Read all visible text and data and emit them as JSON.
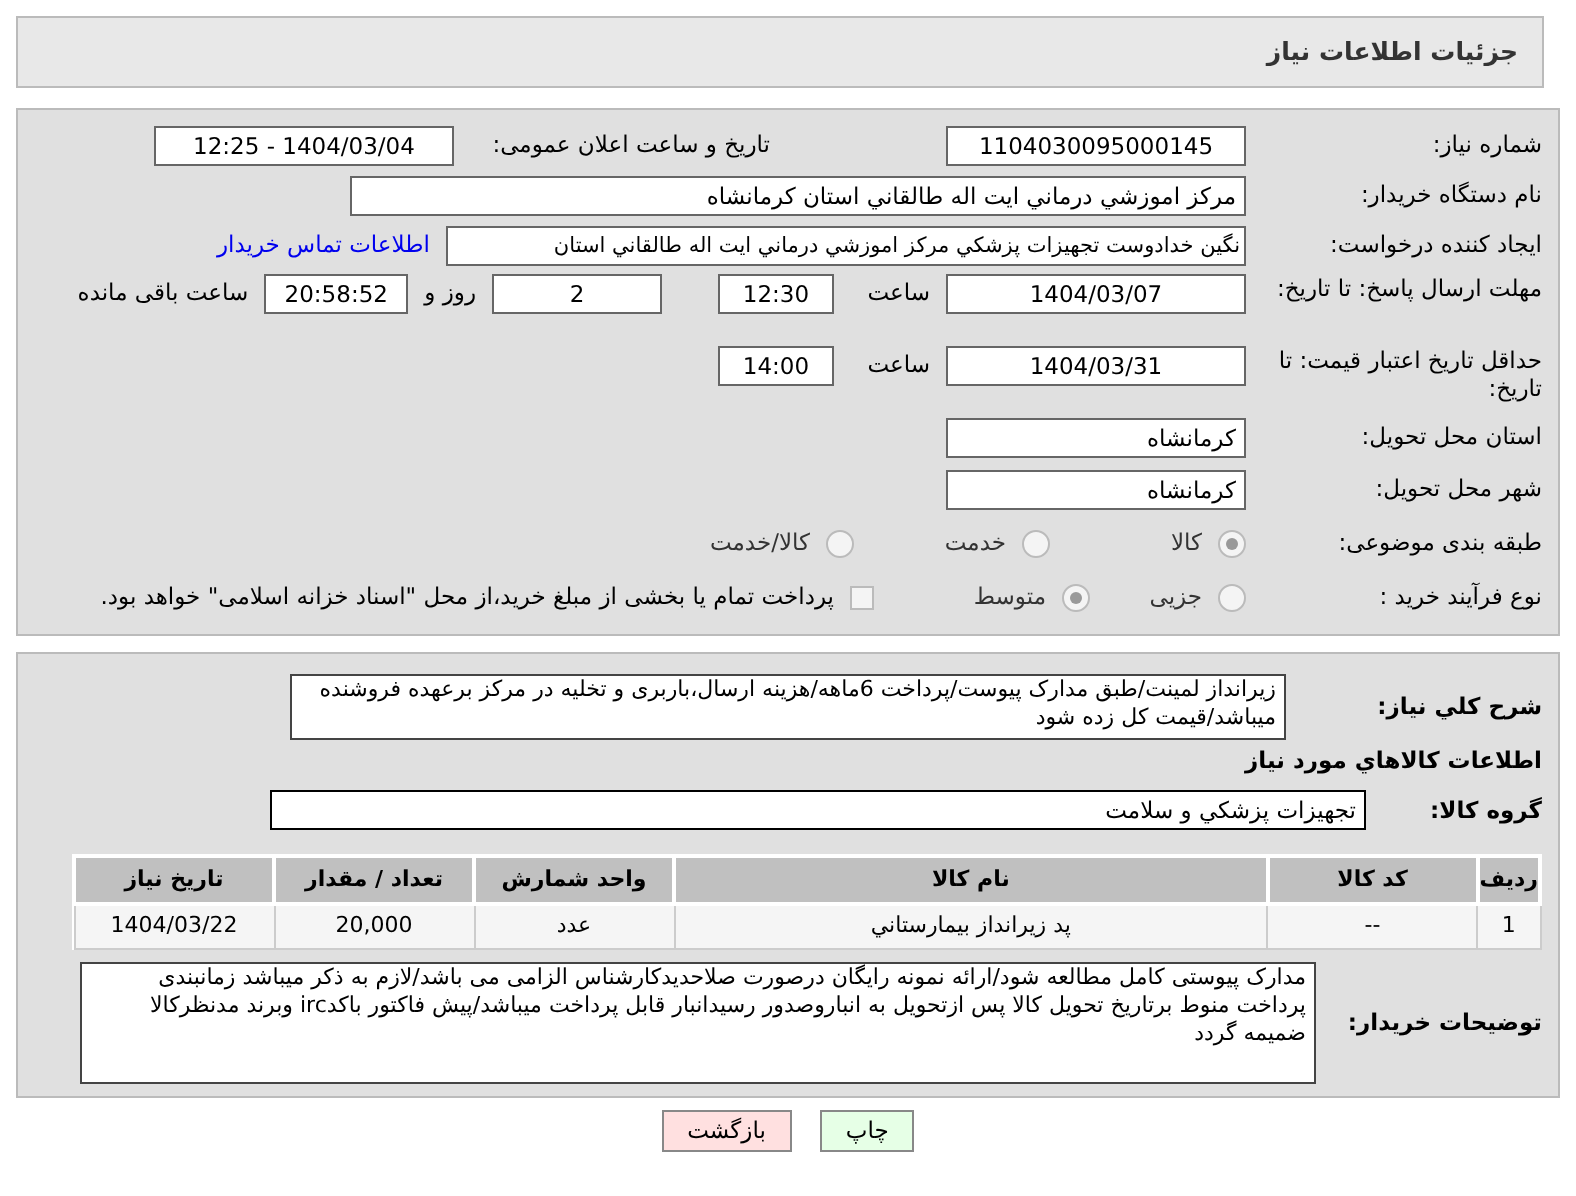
{
  "header": {
    "title": "جزئیات اطلاعات نیاز"
  },
  "fields": {
    "need_number": {
      "label": "شماره نیاز:",
      "value": "1104030095000145"
    },
    "announce": {
      "label": "تاریخ و ساعت اعلان عمومی:",
      "value": "1404/03/04 - 12:25"
    },
    "buyer": {
      "label": "نام دستگاه خریدار:",
      "value": "مرکز اموزشي درماني ايت اله طالقاني استان کرمانشاه"
    },
    "creator": {
      "label": "ایجاد کننده درخواست:",
      "value": "نگين خدادوست تجهيزات پزشکي مرکز اموزشي درماني ايت اله طالقاني استان",
      "link": "اطلاعات تماس خریدار"
    },
    "deadline": {
      "label": "مهلت ارسال پاسخ: تا تاریخ:",
      "date": "1404/03/07",
      "time_label": "ساعت",
      "time": "12:30",
      "days": "2",
      "days_label": "روز و",
      "remaining": "20:58:52",
      "remaining_label": "ساعت باقی مانده"
    },
    "validity": {
      "label": "حداقل تاریخ اعتبار قیمت: تا تاریخ:",
      "date": "1404/03/31",
      "time_label": "ساعت",
      "time": "14:00"
    },
    "province": {
      "label": "استان محل تحویل:",
      "value": "کرمانشاه"
    },
    "city": {
      "label": "شهر محل تحویل:",
      "value": "کرمانشاه"
    }
  },
  "category": {
    "label": "طبقه بندی موضوعی:",
    "options": [
      {
        "label": "کالا",
        "selected": true
      },
      {
        "label": "خدمت",
        "selected": false
      },
      {
        "label": "کالا/خدمت",
        "selected": false
      }
    ]
  },
  "process": {
    "label": "نوع فرآیند خرید :",
    "options": [
      {
        "label": "جزیی",
        "selected": false
      },
      {
        "label": "متوسط",
        "selected": true
      }
    ],
    "treasury": {
      "checked": false,
      "text": "پرداخت تمام یا بخشی از مبلغ خرید،از محل \"اسناد خزانه اسلامی\" خواهد بود."
    }
  },
  "description": {
    "label": "شرح کلي نياز:",
    "value": "زيرانداز لمينت/طبق مدارک پيوست/پرداخت 6ماهه/هزينه ارسال،باربری و تخليه در مرکز برعهده فروشنده ميباشد/قيمت کل زده شود"
  },
  "goods_title": "اطلاعات کالاهاي مورد نياز",
  "group": {
    "label": "گروه کالا:",
    "value": "تجهيزات پزشکي و سلامت"
  },
  "table": {
    "columns": [
      "رديف",
      "کد کالا",
      "نام کالا",
      "واحد شمارش",
      "تعداد / مقدار",
      "تاريخ نياز"
    ],
    "rows": [
      [
        "1",
        "--",
        "پد زيرانداز بيمارستاني",
        "عدد",
        "20,000",
        "1404/03/22"
      ]
    ]
  },
  "notes": {
    "label": "توضیحات خریدار:",
    "value": "مدارک پيوستی کامل مطالعه شود/ارائه نمونه رايگان درصورت صلاحديدکارشناس الزامی می باشد/لازم به ذکر ميباشد زمانبندی پرداخت منوط برتاريخ تحويل کالا پس ازتحويل به انباروصدور رسيدانبار قابل پرداخت ميباشد/پيش فاکتور باکدirc وبرند مدنظرکالا ضميمه گردد"
  },
  "buttons": [
    {
      "kind": "print",
      "label": "چاپ"
    },
    {
      "kind": "back",
      "label": "بازگشت"
    }
  ]
}
